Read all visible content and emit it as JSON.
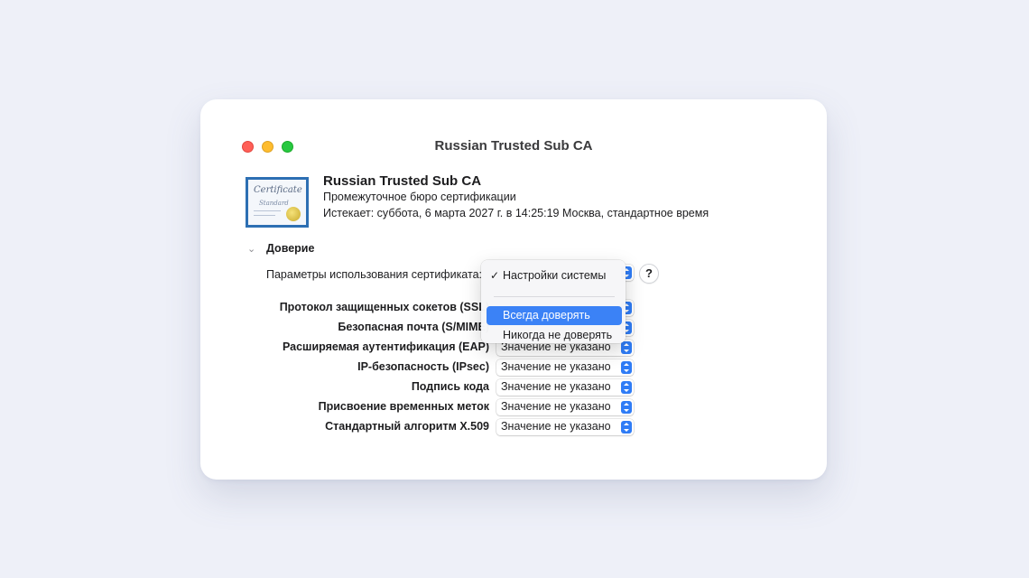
{
  "window": {
    "title": "Russian Trusted Sub CA"
  },
  "certificate": {
    "thumbnail_word_1": "Certificate",
    "thumbnail_word_2": "Standard",
    "name": "Russian Trusted Sub CA",
    "kind": "Промежуточное бюро сертификации",
    "expires": "Истекает: суббота, 6 марта 2027 г. в 14:25:19 Москва, стандартное время"
  },
  "trust": {
    "disclosure_glyph": "⌄",
    "section_title": "Доверие",
    "usage_label": "Параметры использования сертификата:",
    "help_label": "?",
    "menu": {
      "checkmark": "✓",
      "items": [
        {
          "label": "Настройки системы",
          "checked": true,
          "highlighted": false
        },
        {
          "label": "Всегда доверять",
          "checked": false,
          "highlighted": true
        },
        {
          "label": "Никогда не доверять",
          "checked": false,
          "highlighted": false
        }
      ]
    },
    "rows": [
      {
        "label": "Протокол защищенных сокетов (SSL)",
        "value": ""
      },
      {
        "label": "Безопасная почта (S/MIME)",
        "value": ""
      },
      {
        "label": "Расширяемая аутентификация (EAP)",
        "value": "Значение не указано"
      },
      {
        "label": "IP-безопасность (IPsec)",
        "value": "Значение не указано"
      },
      {
        "label": "Подпись кода",
        "value": "Значение не указано"
      },
      {
        "label": "Присвоение временных меток",
        "value": "Значение не указано"
      },
      {
        "label": "Стандартный алгоритм X.509",
        "value": "Значение не указано"
      }
    ]
  },
  "colors": {
    "accent": "#2f7cf6",
    "menu_highlight": "#3b82f6",
    "close": "#ff5f57",
    "minimize": "#febc2e",
    "maximize": "#28c840",
    "certificate_frame": "#2d6fb3"
  }
}
